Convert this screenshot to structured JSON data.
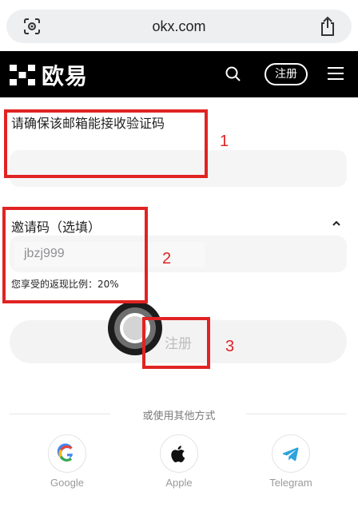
{
  "browser": {
    "url": "okx.com"
  },
  "header": {
    "logo_text": "欧易",
    "register_label": "注册"
  },
  "form": {
    "email_hint": "请确保该邮箱能接收验证码",
    "invite_label": "邀请码（选填）",
    "invite_value": "jbzj999",
    "rebate_text": "您享受的返现比例：20%",
    "register_button": "注册"
  },
  "alt_login": {
    "divider_text": "或使用其他方式",
    "providers": [
      {
        "label": "Google",
        "icon": "google-icon"
      },
      {
        "label": "Apple",
        "icon": "apple-icon"
      },
      {
        "label": "Telegram",
        "icon": "telegram-icon"
      }
    ]
  },
  "annotations": [
    "1",
    "2",
    "3"
  ],
  "colors": {
    "annotation": "#e12323",
    "header_bg": "#000000",
    "telegram": "#2aa3df"
  }
}
